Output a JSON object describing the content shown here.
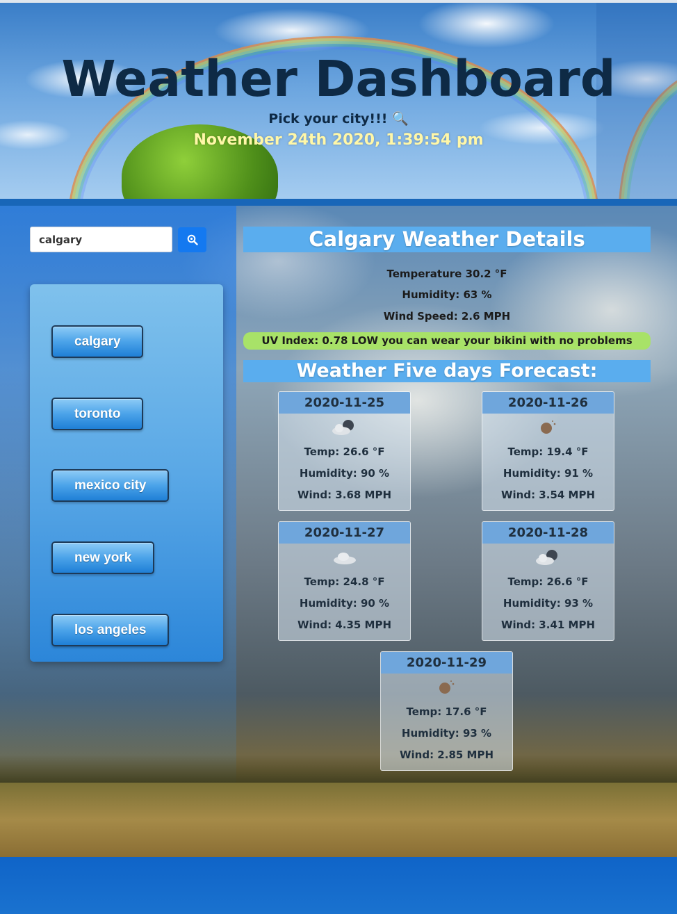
{
  "header": {
    "title": "Weather Dashboard",
    "subtitle": "Pick your city!!! 🔍",
    "datetime": "November 24th 2020, 1:39:54 pm"
  },
  "search": {
    "value": "calgary",
    "button_icon": "search-icon"
  },
  "cities": [
    "calgary",
    "toronto",
    "mexico city",
    "new york",
    "los angeles"
  ],
  "details": {
    "heading": "Calgary Weather Details",
    "temperature": "Temperature 30.2 °F",
    "humidity": "Humidity: 63 %",
    "wind": "Wind Speed: 2.6 MPH",
    "uv": "UV Index: 0.78 LOW you can wear your bikini with no problems",
    "uv_color": "#a8e268"
  },
  "forecast": {
    "heading": "Weather Five days Forecast:",
    "days": [
      {
        "date": "2020-11-25",
        "icon": "partly-cloudy-night-icon",
        "temp": "Temp: 26.6 °F",
        "humidity": "Humidity: 90 %",
        "wind": "Wind: 3.68 MPH"
      },
      {
        "date": "2020-11-26",
        "icon": "clear-night-icon",
        "temp": "Temp: 19.4 °F",
        "humidity": "Humidity: 91 %",
        "wind": "Wind: 3.54 MPH"
      },
      {
        "date": "2020-11-27",
        "icon": "cloud-icon",
        "temp": "Temp: 24.8 °F",
        "humidity": "Humidity: 90 %",
        "wind": "Wind: 4.35 MPH"
      },
      {
        "date": "2020-11-28",
        "icon": "partly-cloudy-night-icon",
        "temp": "Temp: 26.6 °F",
        "humidity": "Humidity: 93 %",
        "wind": "Wind: 3.41 MPH"
      },
      {
        "date": "2020-11-29",
        "icon": "clear-night-icon",
        "temp": "Temp: 17.6 °F",
        "humidity": "Humidity: 93 %",
        "wind": "Wind: 2.85 MPH"
      }
    ]
  },
  "colors": {
    "accent": "#1479f0",
    "band": "#5aadee",
    "card_header": "#6fa6dc",
    "title": "#0e2a45",
    "datetime": "#fff7a8"
  }
}
